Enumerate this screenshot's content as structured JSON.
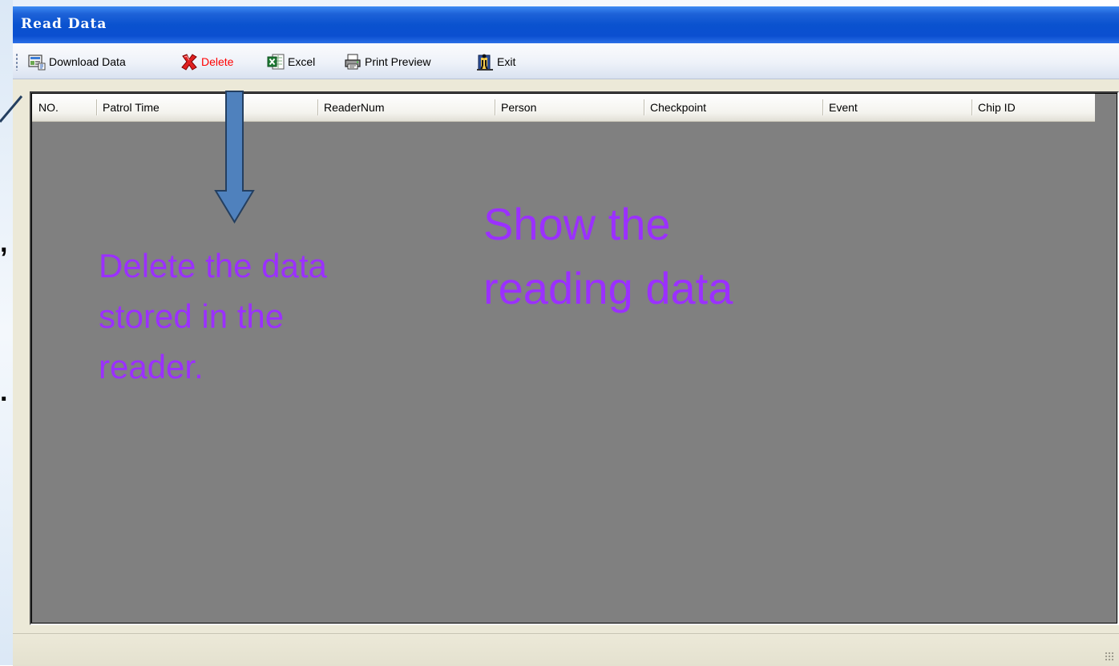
{
  "window": {
    "title": "Read Data"
  },
  "toolbar": {
    "items": [
      {
        "label": "Download Data",
        "icon": "download-data-icon",
        "color": "#000000"
      },
      {
        "label": "Delete",
        "icon": "delete-x-icon",
        "color": "#ff0000"
      },
      {
        "label": "Excel",
        "icon": "excel-icon",
        "color": "#000000"
      },
      {
        "label": "Print Preview",
        "icon": "printer-icon",
        "color": "#000000"
      },
      {
        "label": "Exit",
        "icon": "exit-door-icon",
        "color": "#000000"
      }
    ]
  },
  "grid": {
    "columns": [
      "NO.",
      "Patrol Time",
      "ReaderNum",
      "Person",
      "Checkpoint",
      "Event",
      "Chip ID"
    ],
    "rows": []
  },
  "annotations": {
    "delete_note": [
      "Delete the data",
      "stored in the",
      "reader."
    ],
    "show_note": [
      "Show the",
      "reading data"
    ],
    "text_color": "#9b30ff",
    "arrow_color": "#4f81bd"
  },
  "slide_edge": {
    "glyphs": [
      ",",
      "."
    ]
  }
}
